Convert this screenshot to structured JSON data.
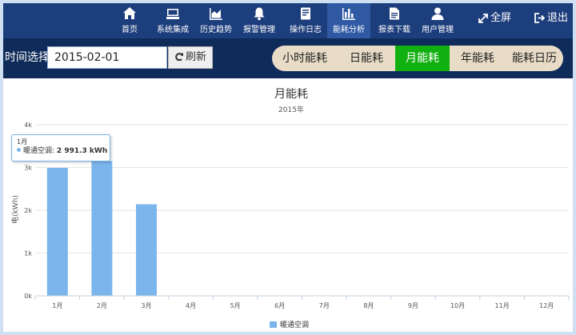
{
  "nav": {
    "items": [
      {
        "label": "首页",
        "icon": "home-icon"
      },
      {
        "label": "系统集成",
        "icon": "monitor-icon"
      },
      {
        "label": "历史趋势",
        "icon": "area-chart-icon"
      },
      {
        "label": "报警管理",
        "icon": "bell-icon"
      },
      {
        "label": "操作日志",
        "icon": "log-icon"
      },
      {
        "label": "能耗分析",
        "icon": "bar-chart-icon",
        "active": true
      },
      {
        "label": "报表下载",
        "icon": "report-icon"
      },
      {
        "label": "用户管理",
        "icon": "user-icon"
      }
    ],
    "fullscreen_label": "全屏",
    "logout_label": "退出"
  },
  "toolbar": {
    "date_label": "时间选择:",
    "date_value": "2015-02-01",
    "refresh_label": "刷新",
    "tabs": [
      "小时能耗",
      "日能耗",
      "月能耗",
      "年能耗",
      "能耗日历"
    ],
    "active_tab": "月能耗"
  },
  "tooltip": {
    "header": "1月",
    "series": "暖通空调",
    "value_text": "2 991.3 kWh"
  },
  "chart_data": {
    "type": "bar",
    "title": "月能耗",
    "subtitle": "2015年",
    "ylabel": "电(kWh)",
    "xlabel": "",
    "categories": [
      "1月",
      "2月",
      "3月",
      "4月",
      "5月",
      "6月",
      "7月",
      "8月",
      "9月",
      "10月",
      "11月",
      "12月"
    ],
    "series": [
      {
        "name": "暖通空调",
        "values": [
          2991.3,
          3150,
          2140,
          0,
          0,
          0,
          0,
          0,
          0,
          0,
          0,
          0
        ]
      }
    ],
    "ylim": [
      0,
      4000
    ],
    "yticks": [
      "0k",
      "1k",
      "2k",
      "3k",
      "4k"
    ],
    "grid": true,
    "legend": "bottom",
    "colors": {
      "bar": "#7cb5ec",
      "grid": "#e6e6e6",
      "axis": "#c0d0e0"
    }
  }
}
